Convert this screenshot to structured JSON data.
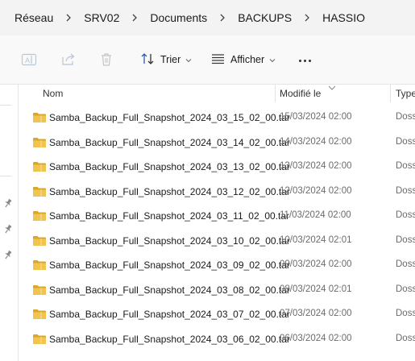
{
  "breadcrumb": {
    "items": [
      {
        "label": "Réseau"
      },
      {
        "label": "SRV02"
      },
      {
        "label": "Documents"
      },
      {
        "label": "BACKUPS"
      },
      {
        "label": "HASSIO"
      }
    ]
  },
  "toolbar": {
    "sort_label": "Trier",
    "view_label": "Afficher"
  },
  "columns": {
    "name": "Nom",
    "modified": "Modifié le",
    "type": "Type"
  },
  "files": [
    {
      "name": "Samba_Backup_Full_Snapshot_2024_03_15_02_00.tar",
      "modified": "15/03/2024 02:00",
      "type": "Doss"
    },
    {
      "name": "Samba_Backup_Full_Snapshot_2024_03_14_02_00.tar",
      "modified": "14/03/2024 02:00",
      "type": "Doss"
    },
    {
      "name": "Samba_Backup_Full_Snapshot_2024_03_13_02_00.tar",
      "modified": "13/03/2024 02:00",
      "type": "Doss"
    },
    {
      "name": "Samba_Backup_Full_Snapshot_2024_03_12_02_00.tar",
      "modified": "12/03/2024 02:00",
      "type": "Doss"
    },
    {
      "name": "Samba_Backup_Full_Snapshot_2024_03_11_02_00.tar",
      "modified": "11/03/2024 02:00",
      "type": "Doss"
    },
    {
      "name": "Samba_Backup_Full_Snapshot_2024_03_10_02_00.tar",
      "modified": "10/03/2024 02:01",
      "type": "Doss"
    },
    {
      "name": "Samba_Backup_Full_Snapshot_2024_03_09_02_00.tar",
      "modified": "09/03/2024 02:00",
      "type": "Doss"
    },
    {
      "name": "Samba_Backup_Full_Snapshot_2024_03_08_02_00.tar",
      "modified": "08/03/2024 02:01",
      "type": "Doss"
    },
    {
      "name": "Samba_Backup_Full_Snapshot_2024_03_07_02_00.tar",
      "modified": "07/03/2024 02:00",
      "type": "Doss"
    },
    {
      "name": "Samba_Backup_Full_Snapshot_2024_03_06_02_00.tar",
      "modified": "06/03/2024 02:00",
      "type": "Doss"
    }
  ],
  "colors": {
    "folder": "#f0c44f",
    "folder_dark": "#d9a72a",
    "accent": "#0067c0"
  },
  "icons": {
    "rename": "rename-icon",
    "share": "share-icon",
    "delete": "trash-icon",
    "sort": "sort-icon",
    "view": "view-lines-icon",
    "more": "more-dots-icon",
    "folder": "folder-icon",
    "pin": "pin-icon"
  }
}
